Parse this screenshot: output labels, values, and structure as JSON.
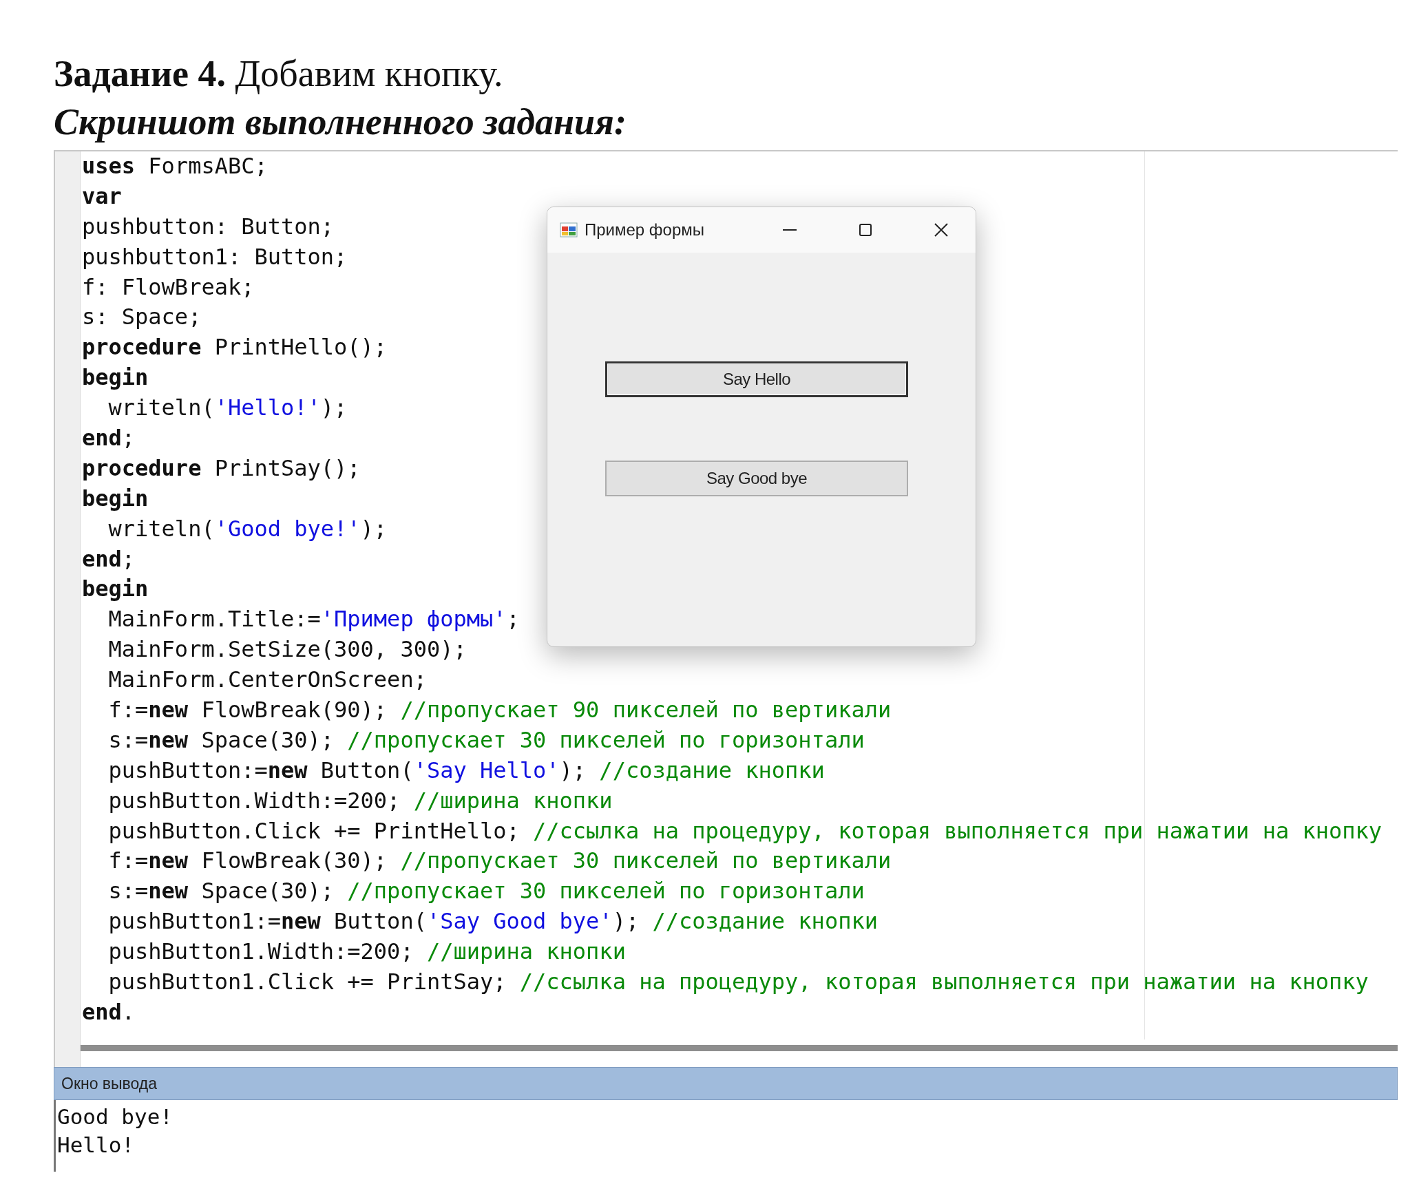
{
  "task_heading": {
    "label": "Задание 4.",
    "title": "Добавим кнопку."
  },
  "subheading": "Скриншот выполненного задания:",
  "editor": {
    "lines": [
      {
        "segments": [
          {
            "kind": "keyword",
            "text": "uses"
          },
          {
            "kind": "plain",
            "text": " FormsABC;"
          }
        ]
      },
      {
        "segments": [
          {
            "kind": "keyword",
            "text": "var"
          }
        ]
      },
      {
        "segments": [
          {
            "kind": "plain",
            "text": "pushbutton: Button;"
          }
        ]
      },
      {
        "segments": [
          {
            "kind": "plain",
            "text": "pushbutton1: Button;"
          }
        ]
      },
      {
        "segments": [
          {
            "kind": "plain",
            "text": "f: FlowBreak;"
          }
        ]
      },
      {
        "segments": [
          {
            "kind": "plain",
            "text": "s: Space;"
          }
        ]
      },
      {
        "segments": [
          {
            "kind": "keyword",
            "text": "procedure"
          },
          {
            "kind": "plain",
            "text": " PrintHello();"
          }
        ]
      },
      {
        "segments": [
          {
            "kind": "keyword",
            "text": "begin"
          }
        ]
      },
      {
        "segments": [
          {
            "kind": "plain",
            "text": "  writeln("
          },
          {
            "kind": "string",
            "text": "'Hello!'"
          },
          {
            "kind": "plain",
            "text": ");"
          }
        ]
      },
      {
        "segments": [
          {
            "kind": "keyword",
            "text": "end"
          },
          {
            "kind": "plain",
            "text": ";"
          }
        ]
      },
      {
        "segments": [
          {
            "kind": "keyword",
            "text": "procedure"
          },
          {
            "kind": "plain",
            "text": " PrintSay();"
          }
        ]
      },
      {
        "segments": [
          {
            "kind": "keyword",
            "text": "begin"
          }
        ]
      },
      {
        "segments": [
          {
            "kind": "plain",
            "text": "  writeln("
          },
          {
            "kind": "string",
            "text": "'Good bye!'"
          },
          {
            "kind": "plain",
            "text": ");"
          }
        ]
      },
      {
        "segments": [
          {
            "kind": "keyword",
            "text": "end"
          },
          {
            "kind": "plain",
            "text": ";"
          }
        ]
      },
      {
        "segments": [
          {
            "kind": "keyword",
            "text": "begin"
          }
        ]
      },
      {
        "segments": [
          {
            "kind": "plain",
            "text": "  MainForm.Title:="
          },
          {
            "kind": "string",
            "text": "'Пример формы'"
          },
          {
            "kind": "plain",
            "text": ";"
          }
        ]
      },
      {
        "segments": [
          {
            "kind": "plain",
            "text": "  MainForm.SetSize(300, 300);"
          }
        ]
      },
      {
        "segments": [
          {
            "kind": "plain",
            "text": "  MainForm.CenterOnScreen;"
          }
        ]
      },
      {
        "segments": [
          {
            "kind": "plain",
            "text": "  f:="
          },
          {
            "kind": "keyword",
            "text": "new"
          },
          {
            "kind": "plain",
            "text": " FlowBreak(90); "
          },
          {
            "kind": "comment",
            "text": "//пропускает 90 пикселей по вертикали"
          }
        ]
      },
      {
        "segments": [
          {
            "kind": "plain",
            "text": "  s:="
          },
          {
            "kind": "keyword",
            "text": "new"
          },
          {
            "kind": "plain",
            "text": " Space(30); "
          },
          {
            "kind": "comment",
            "text": "//пропускает 30 пикселей по горизонтали"
          }
        ]
      },
      {
        "segments": [
          {
            "kind": "plain",
            "text": "  pushButton:="
          },
          {
            "kind": "keyword",
            "text": "new"
          },
          {
            "kind": "plain",
            "text": " Button("
          },
          {
            "kind": "string",
            "text": "'Say Hello'"
          },
          {
            "kind": "plain",
            "text": "); "
          },
          {
            "kind": "comment",
            "text": "//создание кнопки"
          }
        ]
      },
      {
        "segments": [
          {
            "kind": "plain",
            "text": "  pushButton.Width:=200; "
          },
          {
            "kind": "comment",
            "text": "//ширина кнопки"
          }
        ]
      },
      {
        "segments": [
          {
            "kind": "plain",
            "text": "  pushButton.Click += PrintHello; "
          },
          {
            "kind": "comment",
            "text": "//ссылка на процедуру, которая выполняется при нажатии на кнопку"
          }
        ]
      },
      {
        "segments": [
          {
            "kind": "plain",
            "text": "  f:="
          },
          {
            "kind": "keyword",
            "text": "new"
          },
          {
            "kind": "plain",
            "text": " FlowBreak(30); "
          },
          {
            "kind": "comment",
            "text": "//пропускает 30 пикселей по вертикали"
          }
        ]
      },
      {
        "segments": [
          {
            "kind": "plain",
            "text": "  s:="
          },
          {
            "kind": "keyword",
            "text": "new"
          },
          {
            "kind": "plain",
            "text": " Space(30); "
          },
          {
            "kind": "comment",
            "text": "//пропускает 30 пикселей по горизонтали"
          }
        ]
      },
      {
        "segments": [
          {
            "kind": "plain",
            "text": "  pushButton1:="
          },
          {
            "kind": "keyword",
            "text": "new"
          },
          {
            "kind": "plain",
            "text": " Button("
          },
          {
            "kind": "string",
            "text": "'Say Good bye'"
          },
          {
            "kind": "plain",
            "text": "); "
          },
          {
            "kind": "comment",
            "text": "//создание кнопки"
          }
        ]
      },
      {
        "segments": [
          {
            "kind": "plain",
            "text": "  pushButton1.Width:=200; "
          },
          {
            "kind": "comment",
            "text": "//ширина кнопки"
          }
        ]
      },
      {
        "segments": [
          {
            "kind": "plain",
            "text": "  pushButton1.Click += PrintSay; "
          },
          {
            "kind": "comment",
            "text": "//ссылка на процедуру, которая выполняется при нажатии на кнопку"
          }
        ]
      },
      {
        "segments": [
          {
            "kind": "keyword",
            "text": "end"
          },
          {
            "kind": "plain",
            "text": "."
          }
        ]
      }
    ]
  },
  "form_window": {
    "title": "Пример формы",
    "buttons": [
      {
        "label": "Say Hello",
        "default": true
      },
      {
        "label": "Say Good bye",
        "default": false
      }
    ]
  },
  "output": {
    "title": "Окно вывода",
    "lines": [
      "Good bye!",
      "Hello!"
    ]
  }
}
